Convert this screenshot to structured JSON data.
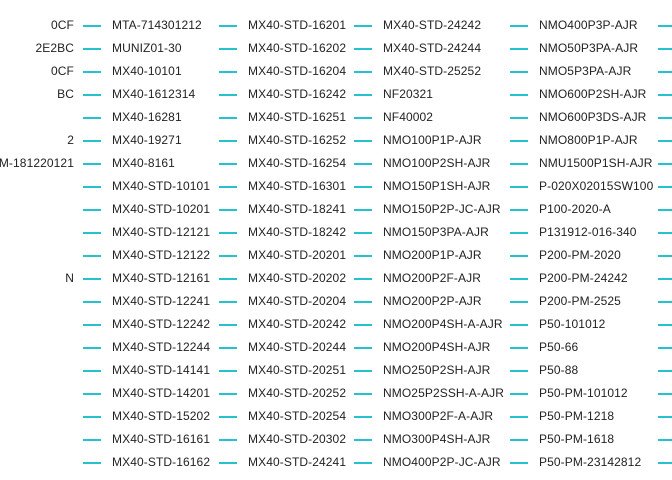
{
  "accent_color": "#26C0CF",
  "text_color": "#222222",
  "columns": [
    {
      "items": [
        "0CF",
        "2E2BC",
        "0CF",
        "BC",
        "",
        "2",
        "M-181220121",
        "",
        "",
        "",
        "",
        "N",
        "",
        "",
        "",
        "",
        "",
        "",
        "",
        ""
      ],
      "has_dash": false
    },
    {
      "items": [
        "MTA-714301212",
        "MUNIZ01-30",
        "MX40-10101",
        "MX40-1612314",
        "MX40-16281",
        "MX40-19271",
        "MX40-8161",
        "MX40-STD-10101",
        "MX40-STD-10201",
        "MX40-STD-12121",
        "MX40-STD-12122",
        "MX40-STD-12161",
        "MX40-STD-12241",
        "MX40-STD-12242",
        "MX40-STD-12244",
        "MX40-STD-14141",
        "MX40-STD-14201",
        "MX40-STD-15202",
        "MX40-STD-16161",
        "MX40-STD-16162"
      ],
      "has_dash": true
    },
    {
      "items": [
        "MX40-STD-16201",
        "MX40-STD-16202",
        "MX40-STD-16204",
        "MX40-STD-16242",
        "MX40-STD-16251",
        "MX40-STD-16252",
        "MX40-STD-16254",
        "MX40-STD-16301",
        "MX40-STD-18241",
        "MX40-STD-18242",
        "MX40-STD-20201",
        "MX40-STD-20202",
        "MX40-STD-20204",
        "MX40-STD-20242",
        "MX40-STD-20244",
        "MX40-STD-20251",
        "MX40-STD-20252",
        "MX40-STD-20254",
        "MX40-STD-20302",
        "MX40-STD-24241"
      ],
      "has_dash": true
    },
    {
      "items": [
        "MX40-STD-24242",
        "MX40-STD-24244",
        "MX40-STD-25252",
        "NF20321",
        "NF40002",
        "NMO100P1P-AJR",
        "NMO100P2SH-AJR",
        "NMO150P1SH-AJR",
        "NMO150P2P-JC-AJR",
        "NMO150P3PA-AJR",
        "NMO200P1P-AJR",
        "NMO200P2F-AJR",
        "NMO200P2P-AJR",
        "NMO200P4SH-A-AJR",
        "NMO200P4SH-AJR",
        "NMO250P2SH-AJR",
        "NMO25P2SSH-A-AJR",
        "NMO300P2F-A-AJR",
        "NMO300P4SH-AJR",
        "NMO400P2P-JC-AJR"
      ],
      "has_dash": true
    },
    {
      "items": [
        "NMO400P3P-AJR",
        "NMO50P3PA-AJR",
        "NMO5P3PA-AJR",
        "NMO600P2SH-AJR",
        "NMO600P3DS-AJR",
        "NMO800P1P-AJR",
        "NMU1500P1SH-AJR",
        "P-020X02015SW100",
        "P100-2020-A",
        "P131912-016-340",
        "P200-PM-2020",
        "P200-PM-24242",
        "P200-PM-2525",
        "P50-101012",
        "P50-66",
        "P50-88",
        "P50-PM-101012",
        "P50-PM-1218",
        "P50-PM-1618",
        "P50-PM-23142812"
      ],
      "has_dash": true
    },
    {
      "items": [
        "",
        "",
        "",
        "",
        "",
        "",
        "",
        "",
        "",
        "",
        "",
        "",
        "",
        "",
        "",
        "",
        "",
        "",
        "",
        ""
      ],
      "has_dash": true
    }
  ]
}
